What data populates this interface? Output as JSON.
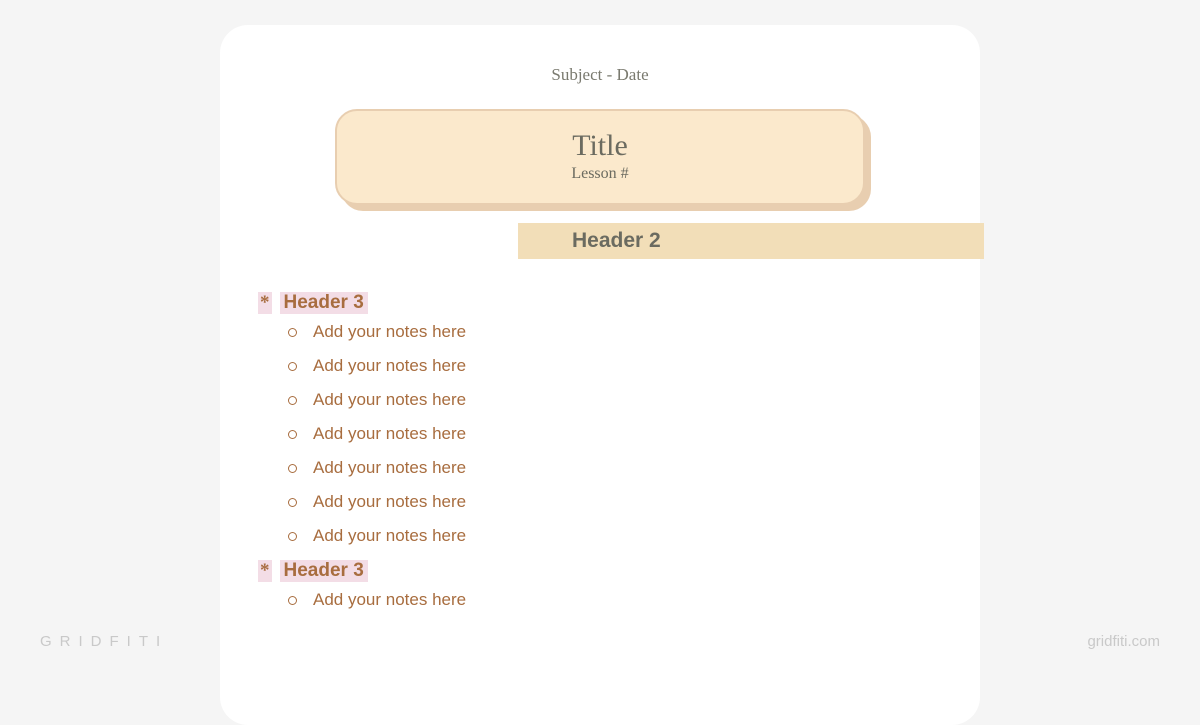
{
  "header": {
    "subject_date": "Subject - Date"
  },
  "title_box": {
    "title": "Title",
    "lesson": "Lesson #"
  },
  "header2": "Header 2",
  "sections": [
    {
      "heading": "Header 3",
      "notes": [
        "Add your notes here",
        "Add your notes here",
        "Add your notes here",
        "Add your notes here",
        "Add your notes here",
        "Add your notes here",
        "Add your notes here"
      ]
    },
    {
      "heading": "Header 3",
      "notes": [
        "Add your notes here"
      ]
    }
  ],
  "watermark": {
    "left": "GRIDFITI",
    "right": "gridfiti.com"
  }
}
